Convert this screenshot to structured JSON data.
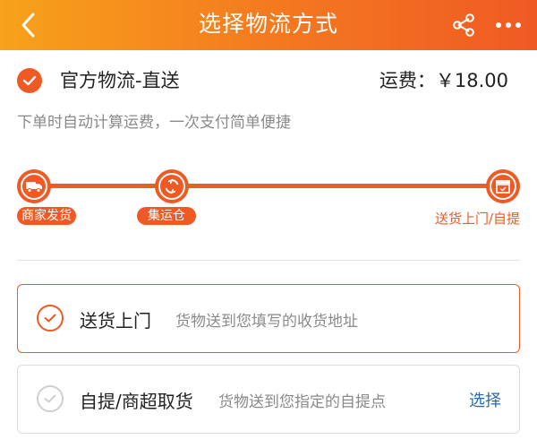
{
  "header": {
    "title": "选择物流方式",
    "back_icon": "chevron-left-icon",
    "share_icon": "share-icon",
    "more_icon": "more-dots-icon"
  },
  "official": {
    "name": "官方物流-直送",
    "fee_label": "运费：",
    "fee_value": "￥18.00",
    "description": "下单时自动计算运费，一次支付简单便捷"
  },
  "flow": {
    "stages": [
      {
        "label": "商家发货",
        "icon": "truck-icon"
      },
      {
        "label": "集运仓",
        "icon": "refresh-icon"
      },
      {
        "label": "送货上门/自提",
        "icon": "box-icon"
      }
    ]
  },
  "options": [
    {
      "title": "送货上门",
      "desc": "货物送到您填写的收货地址",
      "selected": true
    },
    {
      "title": "自提/商超取货",
      "desc": "货物送到您指定的自提点",
      "action": "选择",
      "selected": false
    }
  ],
  "colors": {
    "accent": "#ef5a24",
    "header_gradient_start": "#f7a21b",
    "header_gradient_end": "#ef5a24",
    "link": "#2b6aa8",
    "muted": "#8a8a8a"
  }
}
